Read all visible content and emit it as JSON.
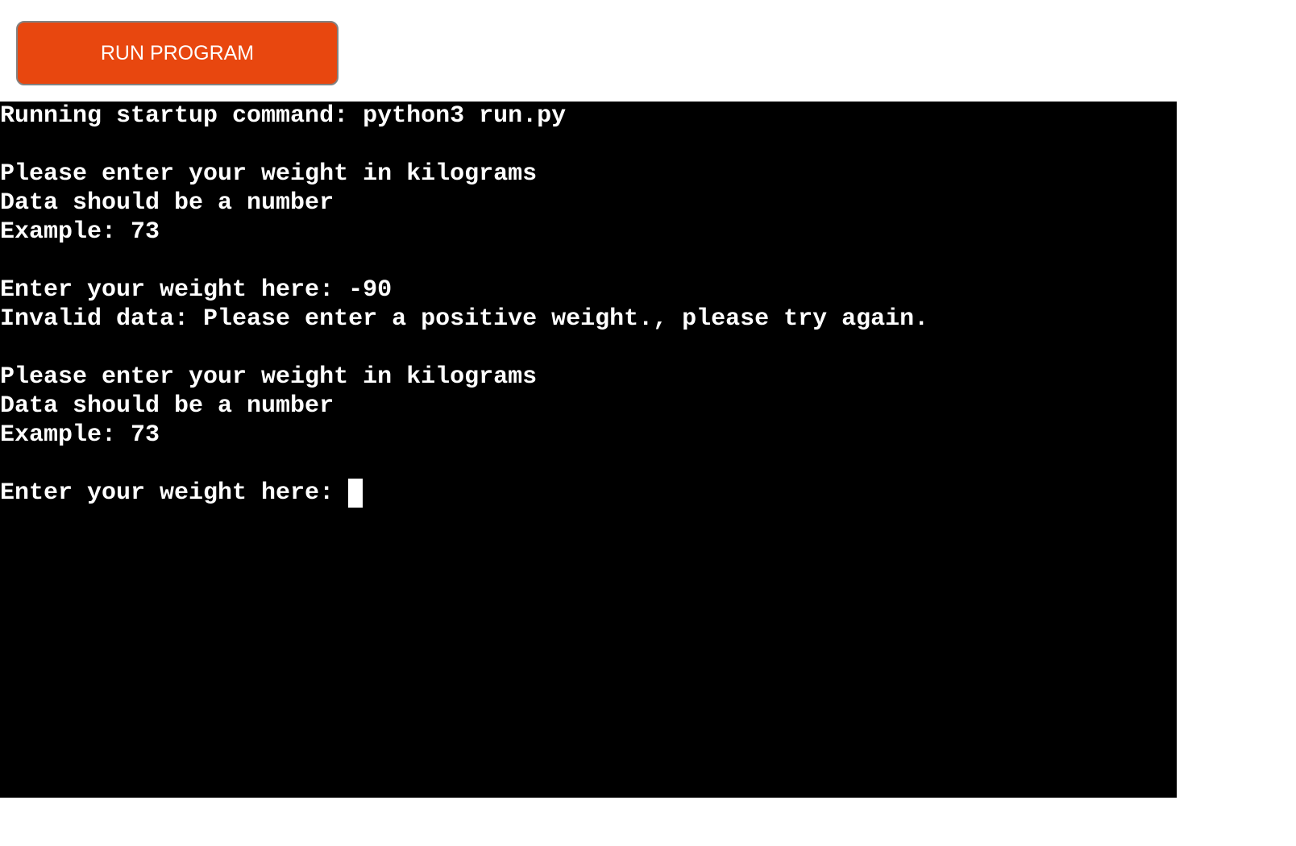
{
  "run_button": {
    "label": "RUN PROGRAM",
    "color": "#e8470f"
  },
  "terminal": {
    "background": "#000000",
    "text_color": "#ffffff",
    "lines": [
      "Running startup command: python3 run.py",
      "",
      "Please enter your weight in kilograms",
      "Data should be a number",
      "Example: 73",
      "",
      "Enter your weight here: -90",
      "Invalid data: Please enter a positive weight., please try again.",
      "",
      "Please enter your weight in kilograms",
      "Data should be a number",
      "Example: 73",
      ""
    ],
    "prompt": "Enter your weight here: ",
    "input_value": ""
  }
}
